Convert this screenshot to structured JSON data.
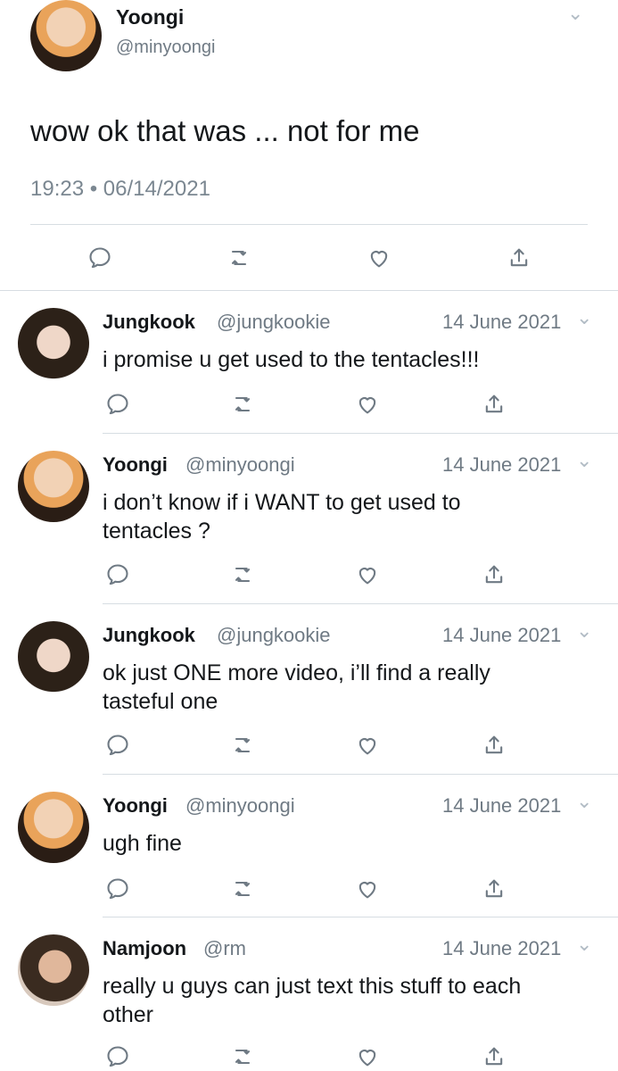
{
  "main_tweet": {
    "name": "Yoongi",
    "handle": "@minyoongi",
    "text": "wow ok that was ... not for me",
    "timestamp": "19:23 • 06/14/2021",
    "chevron_icon": "chevron-down-icon",
    "actions": [
      "reply-icon",
      "retweet-icon",
      "like-icon",
      "share-icon"
    ]
  },
  "replies": [
    {
      "name": "Jungkook",
      "handle": "@jungkookie",
      "date": "14 June 2021",
      "text": "i promise u get used to the tentacles!!!"
    },
    {
      "name": "Yoongi",
      "handle": "@minyoongi",
      "date": "14 June 2021",
      "text": "i don’t know if i WANT to get used to tentacles ?"
    },
    {
      "name": "Jungkook",
      "handle": "@jungkookie",
      "date": "14 June 2021",
      "text": "ok just ONE more video, i’ll find a really tasteful one"
    },
    {
      "name": "Yoongi",
      "handle": "@minyoongi",
      "date": "14 June 2021",
      "text": "ugh fine"
    },
    {
      "name": "Namjoon",
      "handle": "@rm",
      "date": "14 June 2021",
      "text": "really u guys can just text this stuff to each other"
    }
  ]
}
